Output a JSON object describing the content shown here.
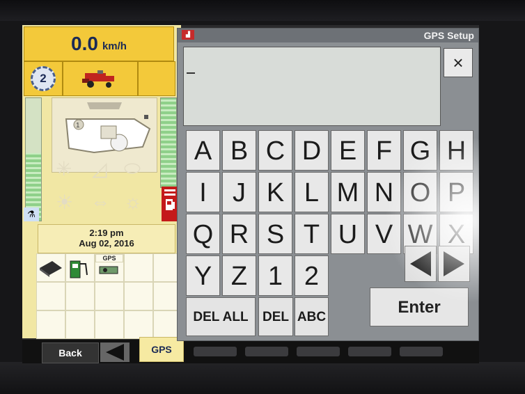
{
  "header": {
    "speed_value": "0.0",
    "speed_unit": "km/h",
    "gear": "2"
  },
  "clock": {
    "time": "2:19 pm",
    "date": "Aug 02, 2016"
  },
  "grid": {
    "gps_label": "GPS"
  },
  "bottom_bar": {
    "back_label": "Back",
    "active_tab": "GPS"
  },
  "dialog": {
    "title": "GPS Setup",
    "input_value": "",
    "close_glyph": "×",
    "keys": [
      "A",
      "B",
      "C",
      "D",
      "E",
      "F",
      "G",
      "H",
      "I",
      "J",
      "K",
      "L",
      "M",
      "N",
      "O",
      "P",
      "Q",
      "R",
      "S",
      "T",
      "U",
      "V",
      "W",
      "X",
      "Y",
      "Z",
      "1",
      "2"
    ],
    "del_all_label": "DEL ALL",
    "del_label": "DEL",
    "abc_label": "ABC",
    "enter_label": "Enter"
  },
  "icons": [
    "gear-icon",
    "combine-icon",
    "machine-diagram",
    "flask-icon",
    "fuel-icon",
    "arrow-left-icon",
    "arrow-right-icon",
    "close-icon"
  ],
  "colors": {
    "accent_yellow": "#f3c93a",
    "panel_cream": "#f1e7a4",
    "dialog_gray": "#8b8f93",
    "key_face": "#e8e8e8"
  }
}
